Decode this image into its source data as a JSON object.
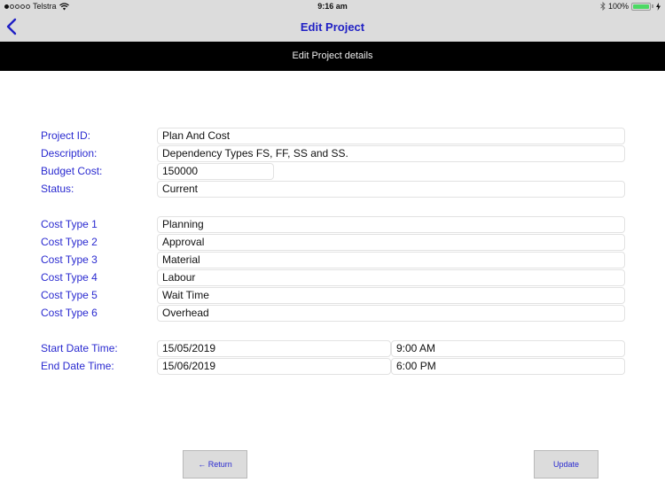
{
  "status_bar": {
    "carrier": "Telstra",
    "time": "9:16 am",
    "battery_percent": "100%",
    "battery_level": 1.0,
    "signal_bars": 1,
    "signal_total": 5
  },
  "nav": {
    "title": "Edit Project",
    "back_icon": "chevron-left-icon"
  },
  "subheader": {
    "title": "Edit Project details"
  },
  "project": {
    "id_label": "Project ID:",
    "id_value": "Plan And Cost",
    "description_label": "Description:",
    "description_value": "Dependency Types FS, FF, SS and SS.",
    "budget_label": "Budget Cost:",
    "budget_value": "150000",
    "status_label": "Status:",
    "status_value": "Current"
  },
  "cost_types": [
    {
      "label": "Cost Type 1",
      "value": "Planning"
    },
    {
      "label": "Cost Type 2",
      "value": "Approval"
    },
    {
      "label": "Cost Type 3",
      "value": "Material"
    },
    {
      "label": "Cost Type 4",
      "value": "Labour"
    },
    {
      "label": "Cost Type 5",
      "value": "Wait Time"
    },
    {
      "label": "Cost Type 6",
      "value": "Overhead"
    }
  ],
  "dates": {
    "start_label": "Start Date Time:",
    "start_date": "15/05/2019",
    "start_time": "9:00 AM",
    "end_label": "End Date Time:",
    "end_date": "15/06/2019",
    "end_time": "6:00 PM"
  },
  "buttons": {
    "return_label": "← Return",
    "update_label": "Update"
  },
  "colors": {
    "accent": "#2a2ad0",
    "bar_background": "#dcdcdc",
    "subheader_background": "#000000",
    "battery": "#4cd964"
  }
}
